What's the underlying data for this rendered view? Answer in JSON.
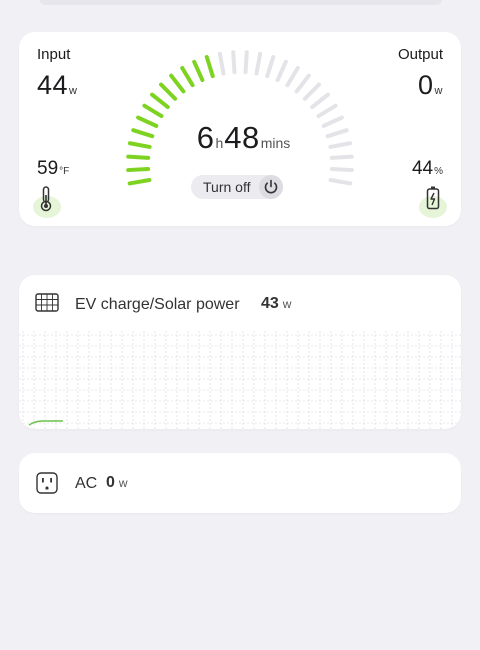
{
  "status": {
    "input_label": "Input",
    "input_value": "44",
    "input_unit": "w",
    "output_label": "Output",
    "output_value": "0",
    "output_unit": "w",
    "temperature_value": "59",
    "temperature_unit": "°F",
    "battery_value": "44",
    "battery_unit": "%",
    "battery_level": 0.44,
    "runtime_hours": "6",
    "runtime_hours_unit": "h",
    "runtime_minutes": "48",
    "runtime_minutes_unit": "mins",
    "turn_off_label": "Turn off"
  },
  "ev_solar": {
    "label": "EV charge/Solar power",
    "value": "43",
    "unit": "w"
  },
  "ac": {
    "label": "AC",
    "value": "0",
    "unit": "w"
  },
  "colors": {
    "accent_green": "#7ed321",
    "gauge_inactive": "#e3e3e8",
    "background": "#f0f0f5",
    "card": "#ffffff"
  },
  "icons": {
    "temperature": "thermometer-icon",
    "battery": "battery-charging-icon",
    "power": "power-icon",
    "solar": "solar-panel-icon",
    "ac": "ac-outlet-icon"
  }
}
